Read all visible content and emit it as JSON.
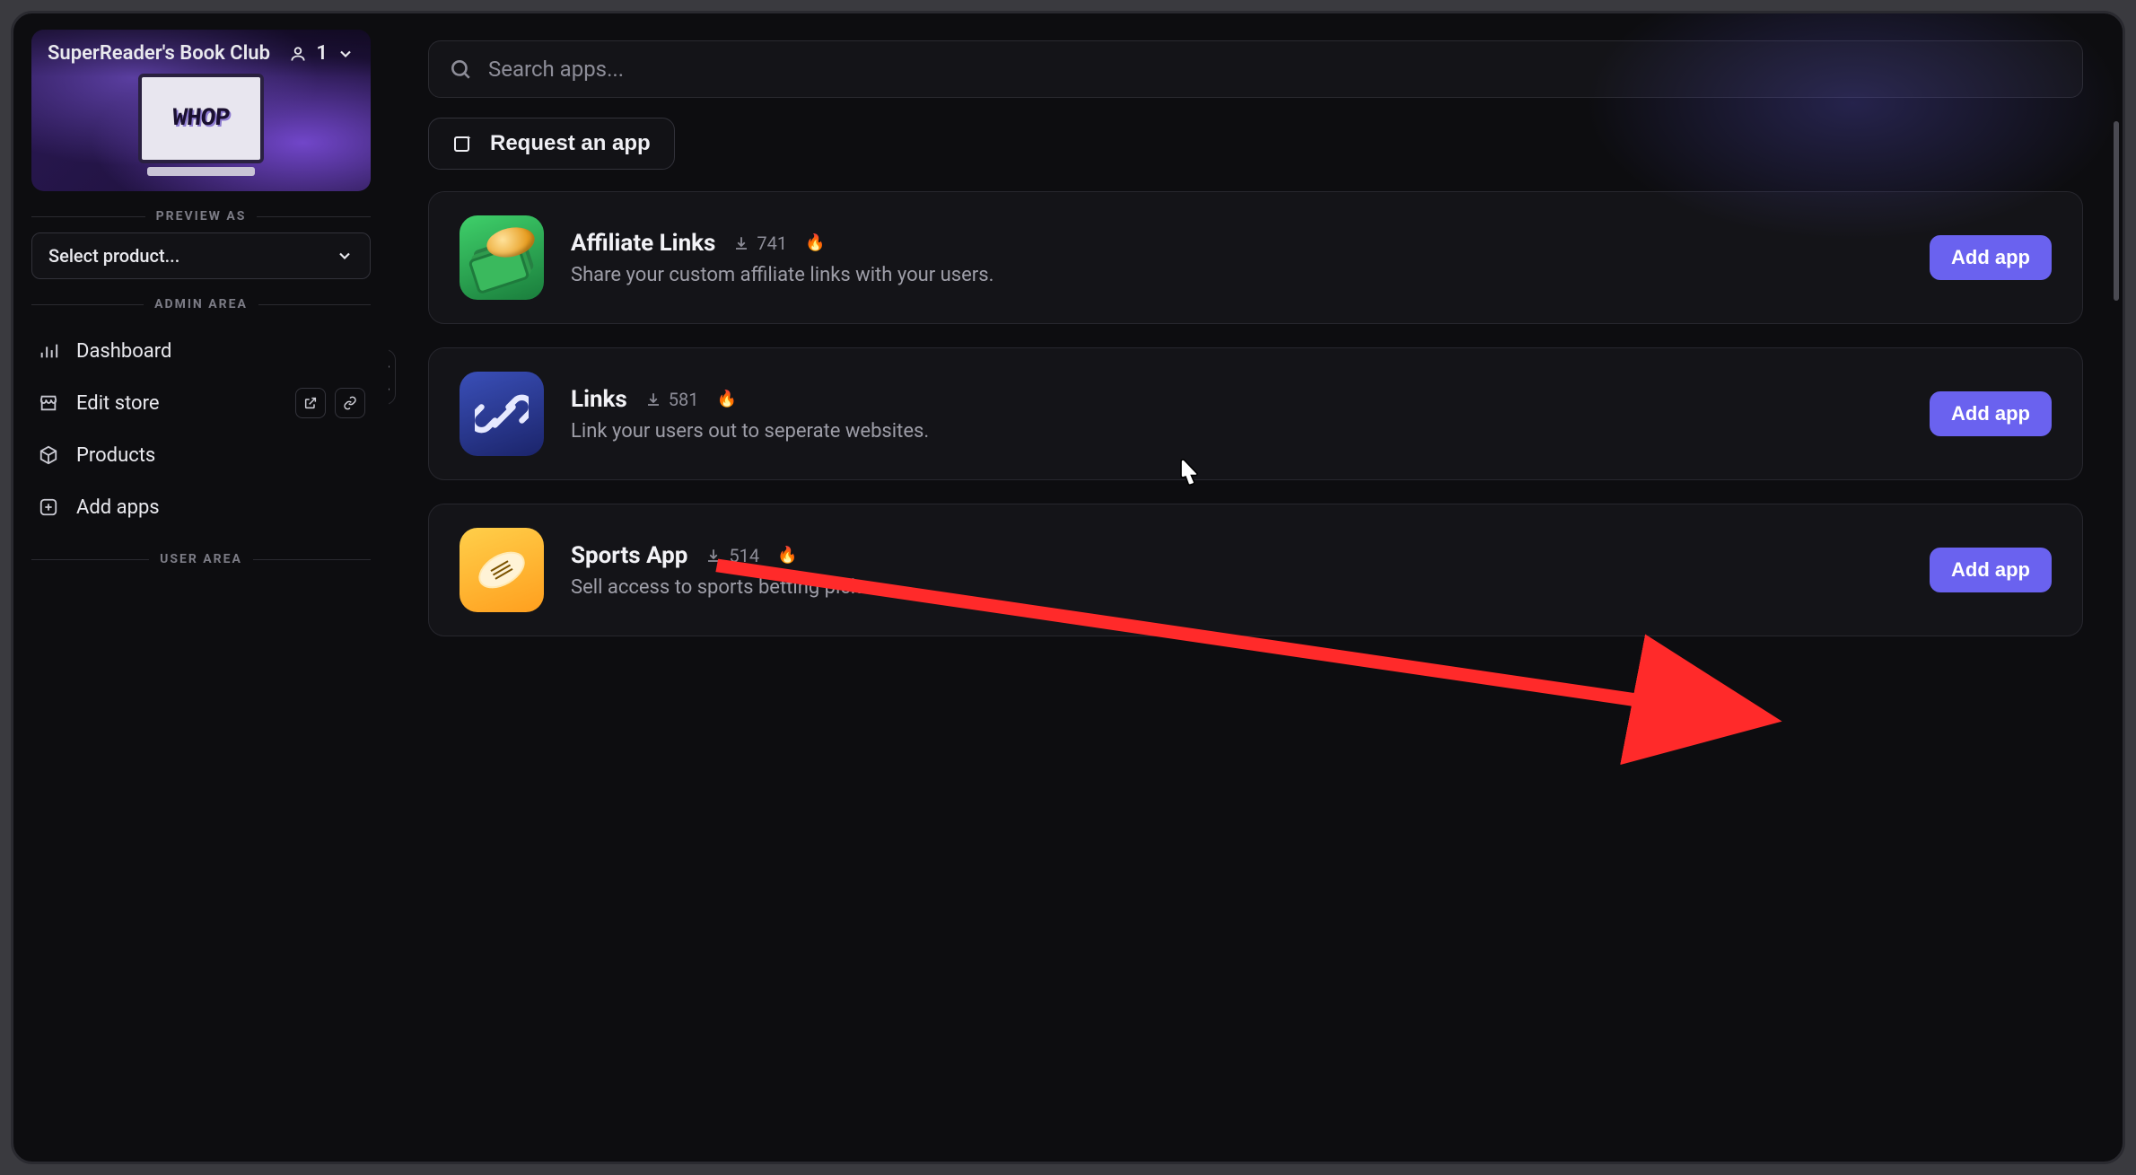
{
  "workspace": {
    "title": "SuperReader's Book Club",
    "member_count": "1"
  },
  "sidebar": {
    "preview_label": "PREVIEW AS",
    "product_select_placeholder": "Select product...",
    "admin_label": "ADMIN AREA",
    "user_label": "USER AREA",
    "nav": {
      "dashboard": "Dashboard",
      "edit_store": "Edit store",
      "products": "Products",
      "add_apps": "Add apps"
    }
  },
  "search": {
    "placeholder": "Search apps..."
  },
  "request_button": "Request an app",
  "add_button_label": "Add app",
  "apps": [
    {
      "id": "affiliate",
      "title": "Affiliate Links",
      "installs": "741",
      "desc": "Share your custom affiliate links with your users."
    },
    {
      "id": "links",
      "title": "Links",
      "installs": "581",
      "desc": "Link your users out to seperate websites."
    },
    {
      "id": "sports",
      "title": "Sports App",
      "installs": "514",
      "desc": "Sell access to sports betting picks."
    }
  ],
  "colors": {
    "accent": "#6a62ef"
  }
}
